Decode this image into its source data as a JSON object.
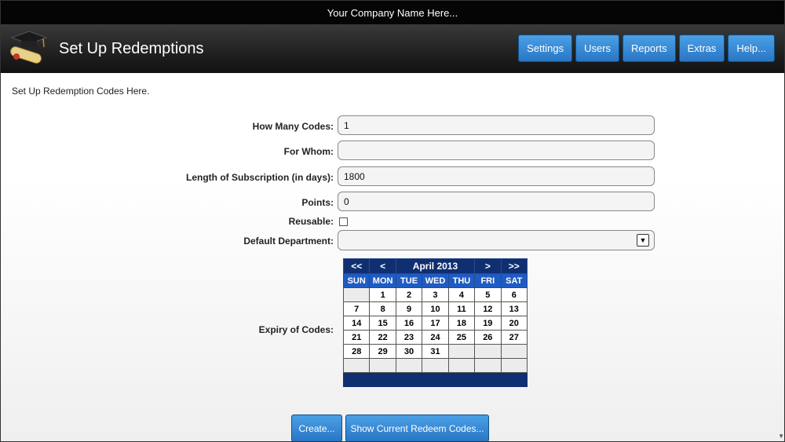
{
  "topbar": {
    "company": "Your Company Name Here..."
  },
  "header": {
    "title": "Set Up Redemptions",
    "nav": [
      "Settings",
      "Users",
      "Reports",
      "Extras",
      "Help..."
    ]
  },
  "intro": "Set Up Redemption Codes Here.",
  "form": {
    "how_many_label": "How Many Codes:",
    "how_many_value": "1",
    "for_whom_label": "For Whom:",
    "for_whom_value": "",
    "length_label": "Length of Subscription (in days):",
    "length_value": "1800",
    "points_label": "Points:",
    "points_value": "0",
    "reusable_label": "Reusable:",
    "reusable_checked": false,
    "department_label": "Default Department:",
    "department_value": "",
    "expiry_label": "Expiry of Codes:"
  },
  "calendar": {
    "prev_year": "<<",
    "prev_month": "<",
    "month_label": "April 2013",
    "next_month": ">",
    "next_year": ">>",
    "days_of_week": [
      "SUN",
      "MON",
      "TUE",
      "WED",
      "THU",
      "FRI",
      "SAT"
    ],
    "weeks": [
      [
        "",
        "1",
        "2",
        "3",
        "4",
        "5",
        "6"
      ],
      [
        "7",
        "8",
        "9",
        "10",
        "11",
        "12",
        "13"
      ],
      [
        "14",
        "15",
        "16",
        "17",
        "18",
        "19",
        "20"
      ],
      [
        "21",
        "22",
        "23",
        "24",
        "25",
        "26",
        "27"
      ],
      [
        "28",
        "29",
        "30",
        "31",
        "",
        "",
        ""
      ],
      [
        "",
        "",
        "",
        "",
        "",
        "",
        ""
      ]
    ]
  },
  "buttons": {
    "create": "Create...",
    "show_codes": "Show Current Redeem Codes..."
  },
  "colors": {
    "accent": "#2a76c4",
    "calendar_header": "#0f2f70",
    "calendar_dow": "#1f5bc4"
  }
}
